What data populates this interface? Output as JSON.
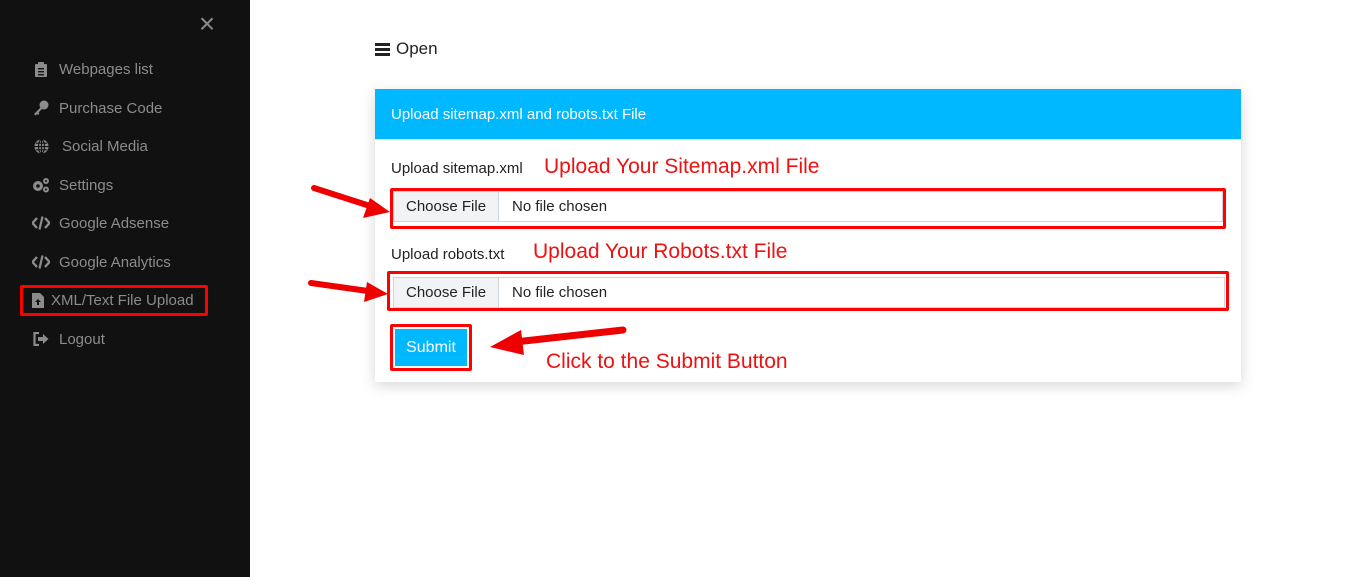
{
  "sidebar": {
    "close_icon": "×",
    "items": [
      {
        "label": "Webpages list",
        "icon": "clipboard-list-icon"
      },
      {
        "label": "Purchase Code",
        "icon": "key-icon"
      },
      {
        "label": "Social Media",
        "icon": "globe-icon"
      },
      {
        "label": "Settings",
        "icon": "cogs-icon"
      },
      {
        "label": "Google Adsense",
        "icon": "code-icon"
      },
      {
        "label": "Google Analytics",
        "icon": "code-icon"
      },
      {
        "label": "XML/Text File Upload",
        "icon": "file-upload-icon",
        "active": true
      },
      {
        "label": "Logout",
        "icon": "sign-out-icon"
      }
    ]
  },
  "main": {
    "open_label": "Open",
    "card": {
      "title": "Upload sitemap.xml and robots.txt File",
      "fields": [
        {
          "label": "Upload sitemap.xml",
          "button": "Choose File",
          "status": "No file chosen",
          "annotation": "Upload Your Sitemap.xml File"
        },
        {
          "label": "Upload robots.txt",
          "button": "Choose File",
          "status": "No file chosen",
          "annotation": "Upload Your Robots.txt File"
        }
      ],
      "submit_label": "Submit",
      "submit_annotation": "Click to the Submit Button"
    }
  },
  "colors": {
    "sidebar_bg": "#111111",
    "accent": "#00b8ff",
    "annotation_red": "#ff0000"
  }
}
